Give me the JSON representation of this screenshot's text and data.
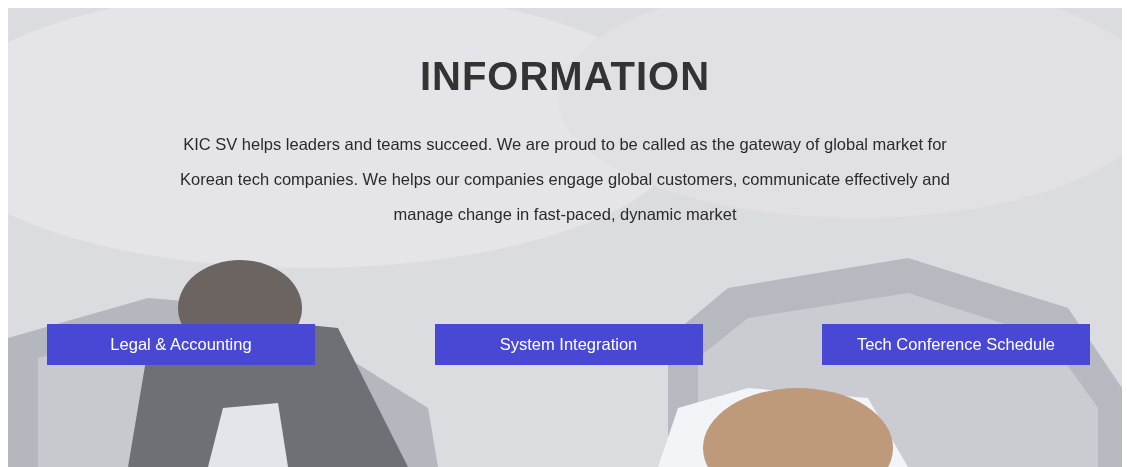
{
  "section": {
    "title": "INFORMATION",
    "description": "KIC SV helps leaders and teams succeed. We are proud to be called as the gateway of global market for Korean tech companies. We helps our companies engage global customers, communicate effectively and manage change in fast-paced, dynamic market"
  },
  "buttons": [
    {
      "label": "Legal & Accounting"
    },
    {
      "label": "System Integration"
    },
    {
      "label": "Tech Conference Schedule"
    }
  ]
}
